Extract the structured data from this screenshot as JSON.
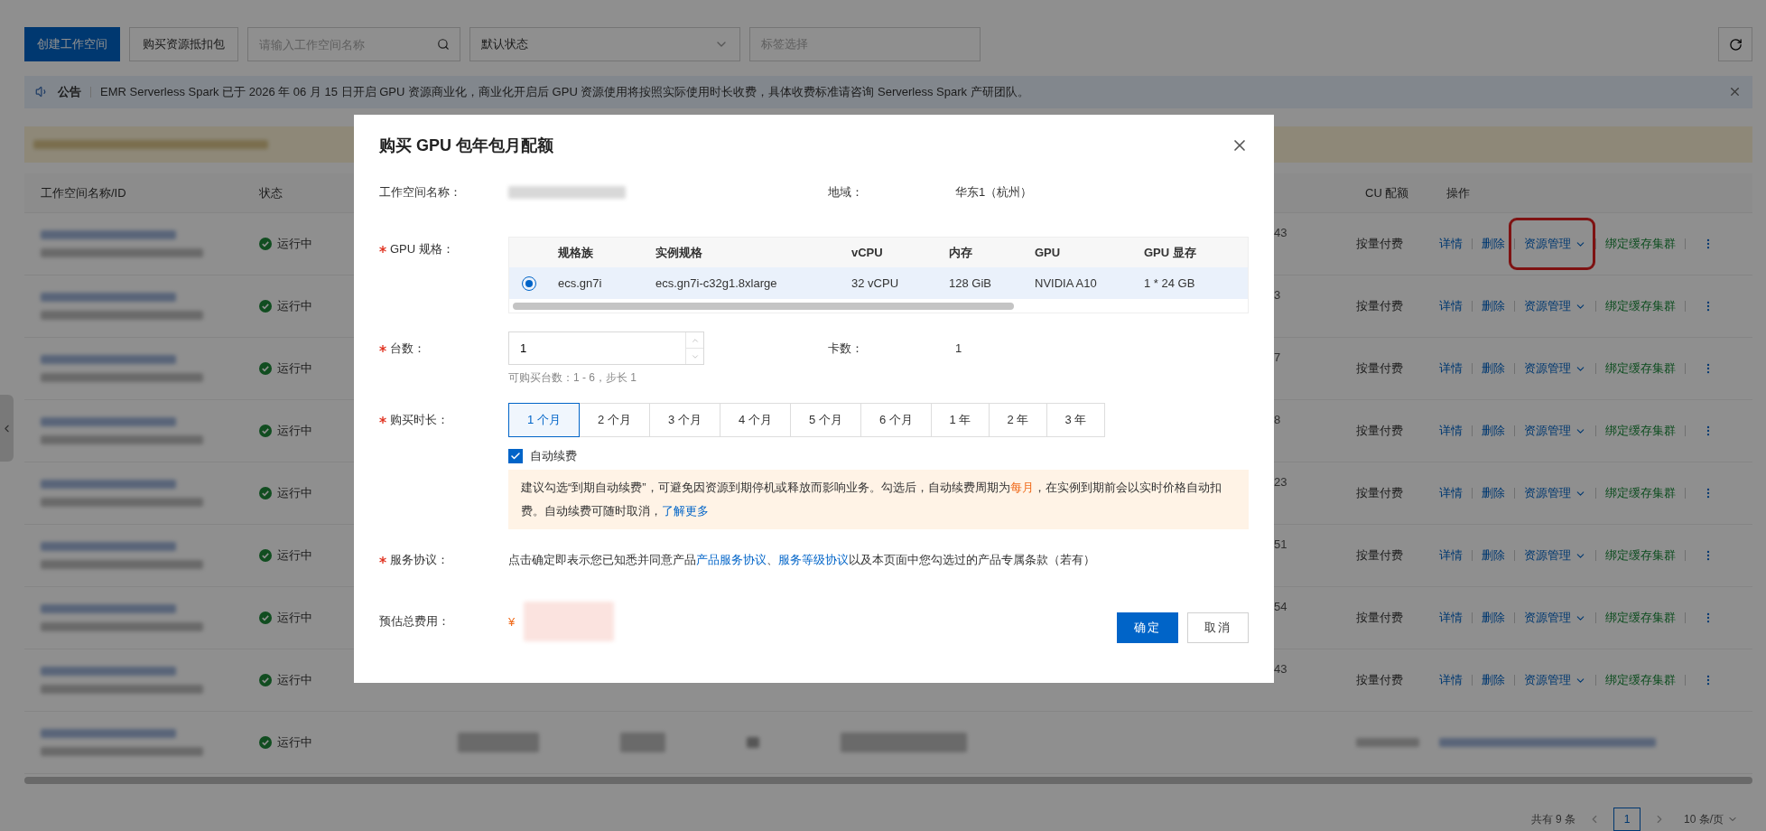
{
  "toolbar": {
    "create_button": "创建工作空间",
    "buy_button": "购买资源抵扣包",
    "search": {
      "placeholder": "请输入工作空间名称"
    },
    "status_select": {
      "value": "默认状态"
    },
    "tag_select": {
      "placeholder": "标签选择"
    }
  },
  "announcement": {
    "label": "公告",
    "text": "EMR Serverless Spark 已于 2026 年 06 月 15 日开启 GPU 资源商业化，商业化开启后 GPU 资源使用将按照实际使用时长收费，具体收费标准请咨询 Serverless Spark 产研团队。"
  },
  "table": {
    "columns": [
      {
        "label": "工作空间名称/ID"
      },
      {
        "label": "状态"
      },
      {
        "label": "CU 配额"
      },
      {
        "label": "操作"
      }
    ],
    "rows": [
      {
        "kind": "normal",
        "status": "运行中",
        "column_3": "43",
        "billing": "按量付费",
        "annotated": true,
        "actions": [
          {
            "label": "详情",
            "kind": "link"
          },
          {
            "label": "删除",
            "kind": "link"
          },
          {
            "label": "资源管理",
            "kind": "dropdown"
          },
          {
            "label": "绑定缓存集群",
            "kind": "bind"
          }
        ]
      },
      {
        "kind": "normal",
        "status": "运行中",
        "column_3": "3",
        "billing": "按量付费",
        "annotated": false,
        "actions": [
          {
            "label": "详情",
            "kind": "link"
          },
          {
            "label": "删除",
            "kind": "link"
          },
          {
            "label": "资源管理",
            "kind": "dropdown"
          },
          {
            "label": "绑定缓存集群",
            "kind": "bind"
          }
        ]
      },
      {
        "kind": "normal",
        "status": "运行中",
        "column_3": "7",
        "billing": "按量付费",
        "annotated": false,
        "actions": [
          {
            "label": "详情",
            "kind": "link"
          },
          {
            "label": "删除",
            "kind": "link"
          },
          {
            "label": "资源管理",
            "kind": "dropdown"
          },
          {
            "label": "绑定缓存集群",
            "kind": "bind"
          }
        ]
      },
      {
        "kind": "normal",
        "status": "运行中",
        "column_3": "8",
        "billing": "按量付费",
        "annotated": false,
        "actions": [
          {
            "label": "详情",
            "kind": "link"
          },
          {
            "label": "删除",
            "kind": "link"
          },
          {
            "label": "资源管理",
            "kind": "dropdown"
          },
          {
            "label": "绑定缓存集群",
            "kind": "bind"
          }
        ]
      },
      {
        "kind": "normal",
        "status": "运行中",
        "column_3": "23",
        "billing": "按量付费",
        "annotated": false,
        "actions": [
          {
            "label": "详情",
            "kind": "link"
          },
          {
            "label": "删除",
            "kind": "link"
          },
          {
            "label": "资源管理",
            "kind": "dropdown"
          },
          {
            "label": "绑定缓存集群",
            "kind": "bind"
          }
        ]
      },
      {
        "kind": "normal",
        "status": "运行中",
        "column_3": "51",
        "billing": "按量付费",
        "annotated": false,
        "actions": [
          {
            "label": "详情",
            "kind": "link"
          },
          {
            "label": "删除",
            "kind": "link"
          },
          {
            "label": "资源管理",
            "kind": "dropdown"
          },
          {
            "label": "绑定缓存集群",
            "kind": "bind"
          }
        ]
      },
      {
        "kind": "normal",
        "status": "运行中",
        "column_3": "54",
        "billing": "按量付费",
        "annotated": false,
        "actions": [
          {
            "label": "详情",
            "kind": "link"
          },
          {
            "label": "删除",
            "kind": "link"
          },
          {
            "label": "资源管理",
            "kind": "dropdown"
          },
          {
            "label": "绑定缓存集群",
            "kind": "bind"
          }
        ]
      },
      {
        "kind": "normal",
        "status": "运行中",
        "column_3": "43",
        "billing": "按量付费",
        "annotated": false,
        "actions": [
          {
            "label": "详情",
            "kind": "link"
          },
          {
            "label": "删除",
            "kind": "link"
          },
          {
            "label": "资源管理",
            "kind": "dropdown"
          },
          {
            "label": "绑定缓存集群",
            "kind": "bind"
          }
        ]
      },
      {
        "kind": "redacted",
        "status": "运行中"
      }
    ]
  },
  "pagination": {
    "total": "共有 9 条",
    "pages": [
      {
        "label": "1",
        "selected": true
      }
    ],
    "page_size": "10 条/页"
  },
  "modal": {
    "title": "购买 GPU 包年包月配额",
    "workspace": {
      "label": "工作空间名称：",
      "required": false
    },
    "region": {
      "label": "地域：",
      "value": "华东1（杭州）"
    },
    "gpu_spec": {
      "label": "GPU 规格：",
      "required": true,
      "columns": [
        "规格族",
        "实例规格",
        "vCPU",
        "内存",
        "GPU",
        "GPU 显存"
      ],
      "rows": [
        {
          "selected": true,
          "cells": [
            "ecs.gn7i",
            "ecs.gn7i-c32g1.8xlarge",
            "32 vCPU",
            "128 GiB",
            "NVIDIA A10",
            "1 * 24 GB"
          ]
        }
      ]
    },
    "quantity": {
      "label": "台数：",
      "required": true,
      "value": "1",
      "hint": "可购买台数：1 - 6，步长 1"
    },
    "cards": {
      "label": "卡数：",
      "value": "1"
    },
    "duration": {
      "label": "购买时长：",
      "required": true,
      "options": [
        {
          "label": "1 个月",
          "selected": true
        },
        {
          "label": "2 个月",
          "selected": false
        },
        {
          "label": "3 个月",
          "selected": false
        },
        {
          "label": "4 个月",
          "selected": false
        },
        {
          "label": "5 个月",
          "selected": false
        },
        {
          "label": "6 个月",
          "selected": false
        },
        {
          "label": "1 年",
          "selected": false
        },
        {
          "label": "2 年",
          "selected": false
        },
        {
          "label": "3 年",
          "selected": false
        }
      ]
    },
    "auto_renew": {
      "label": "自动续费",
      "checked": true
    },
    "notice": [
      {
        "kind": "plain",
        "text": "建议勾选“到期自动续费”，可避免因资源到期停机或释放而影响业务。勾选后，自动续费周期为"
      },
      {
        "kind": "emphasis",
        "text": "每月"
      },
      {
        "kind": "plain",
        "text": "，在实例到期前会以实时价格自动扣费。自动续费可随时取消，"
      },
      {
        "kind": "link",
        "text": "了解更多"
      }
    ],
    "agreement": {
      "label": "服务协议：",
      "required": true,
      "segments": [
        {
          "kind": "plain",
          "text": "点击确定即表示您已知悉并同意产品"
        },
        {
          "kind": "link",
          "text": "产品服务协议"
        },
        {
          "kind": "plain",
          "text": "、"
        },
        {
          "kind": "link",
          "text": "服务等级协议"
        },
        {
          "kind": "plain",
          "text": "以及本页面中您勾选过的产品专属条款（若有）"
        }
      ]
    },
    "estimate": {
      "label": "预估总费用：",
      "required": false,
      "currency": "¥"
    },
    "buttons": [
      {
        "label": "确定",
        "kind": "primary"
      },
      {
        "label": "取消",
        "kind": "secondary"
      }
    ]
  }
}
